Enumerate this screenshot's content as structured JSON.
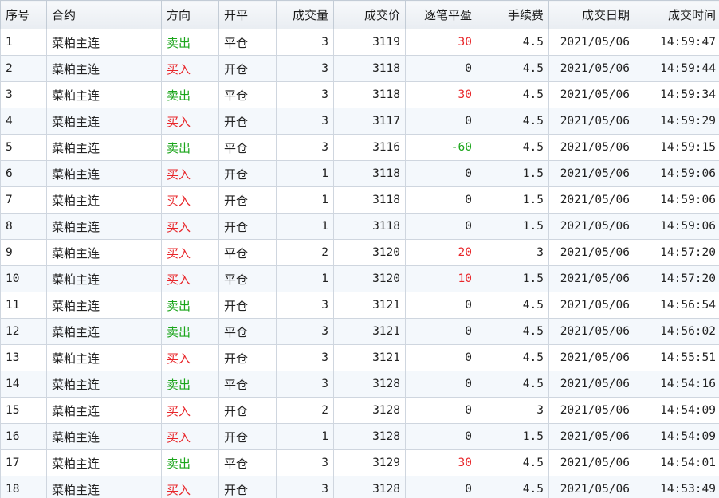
{
  "table": {
    "headers": [
      "序号",
      "合约",
      "方向",
      "开平",
      "成交量",
      "成交价",
      "逐笔平盈",
      "手续费",
      "成交日期",
      "成交时间"
    ],
    "rows": [
      {
        "seq": "1",
        "contract": "菜粕主连",
        "direction": "卖出",
        "dir_type": "sell",
        "offset": "平仓",
        "volume": "3",
        "price": "3119",
        "pnl": "30",
        "pnl_type": "pos",
        "fee": "4.5",
        "date": "2021/05/06",
        "time": "14:59:47"
      },
      {
        "seq": "2",
        "contract": "菜粕主连",
        "direction": "买入",
        "dir_type": "buy",
        "offset": "开仓",
        "volume": "3",
        "price": "3118",
        "pnl": "0",
        "pnl_type": "zero",
        "fee": "4.5",
        "date": "2021/05/06",
        "time": "14:59:44"
      },
      {
        "seq": "3",
        "contract": "菜粕主连",
        "direction": "卖出",
        "dir_type": "sell",
        "offset": "平仓",
        "volume": "3",
        "price": "3118",
        "pnl": "30",
        "pnl_type": "pos",
        "fee": "4.5",
        "date": "2021/05/06",
        "time": "14:59:34"
      },
      {
        "seq": "4",
        "contract": "菜粕主连",
        "direction": "买入",
        "dir_type": "buy",
        "offset": "开仓",
        "volume": "3",
        "price": "3117",
        "pnl": "0",
        "pnl_type": "zero",
        "fee": "4.5",
        "date": "2021/05/06",
        "time": "14:59:29"
      },
      {
        "seq": "5",
        "contract": "菜粕主连",
        "direction": "卖出",
        "dir_type": "sell",
        "offset": "平仓",
        "volume": "3",
        "price": "3116",
        "pnl": "-60",
        "pnl_type": "neg",
        "fee": "4.5",
        "date": "2021/05/06",
        "time": "14:59:15"
      },
      {
        "seq": "6",
        "contract": "菜粕主连",
        "direction": "买入",
        "dir_type": "buy",
        "offset": "开仓",
        "volume": "1",
        "price": "3118",
        "pnl": "0",
        "pnl_type": "zero",
        "fee": "1.5",
        "date": "2021/05/06",
        "time": "14:59:06"
      },
      {
        "seq": "7",
        "contract": "菜粕主连",
        "direction": "买入",
        "dir_type": "buy",
        "offset": "开仓",
        "volume": "1",
        "price": "3118",
        "pnl": "0",
        "pnl_type": "zero",
        "fee": "1.5",
        "date": "2021/05/06",
        "time": "14:59:06"
      },
      {
        "seq": "8",
        "contract": "菜粕主连",
        "direction": "买入",
        "dir_type": "buy",
        "offset": "开仓",
        "volume": "1",
        "price": "3118",
        "pnl": "0",
        "pnl_type": "zero",
        "fee": "1.5",
        "date": "2021/05/06",
        "time": "14:59:06"
      },
      {
        "seq": "9",
        "contract": "菜粕主连",
        "direction": "买入",
        "dir_type": "buy",
        "offset": "平仓",
        "volume": "2",
        "price": "3120",
        "pnl": "20",
        "pnl_type": "pos",
        "fee": "3",
        "date": "2021/05/06",
        "time": "14:57:20"
      },
      {
        "seq": "10",
        "contract": "菜粕主连",
        "direction": "买入",
        "dir_type": "buy",
        "offset": "平仓",
        "volume": "1",
        "price": "3120",
        "pnl": "10",
        "pnl_type": "pos",
        "fee": "1.5",
        "date": "2021/05/06",
        "time": "14:57:20"
      },
      {
        "seq": "11",
        "contract": "菜粕主连",
        "direction": "卖出",
        "dir_type": "sell",
        "offset": "开仓",
        "volume": "3",
        "price": "3121",
        "pnl": "0",
        "pnl_type": "zero",
        "fee": "4.5",
        "date": "2021/05/06",
        "time": "14:56:54"
      },
      {
        "seq": "12",
        "contract": "菜粕主连",
        "direction": "卖出",
        "dir_type": "sell",
        "offset": "平仓",
        "volume": "3",
        "price": "3121",
        "pnl": "0",
        "pnl_type": "zero",
        "fee": "4.5",
        "date": "2021/05/06",
        "time": "14:56:02"
      },
      {
        "seq": "13",
        "contract": "菜粕主连",
        "direction": "买入",
        "dir_type": "buy",
        "offset": "开仓",
        "volume": "3",
        "price": "3121",
        "pnl": "0",
        "pnl_type": "zero",
        "fee": "4.5",
        "date": "2021/05/06",
        "time": "14:55:51"
      },
      {
        "seq": "14",
        "contract": "菜粕主连",
        "direction": "卖出",
        "dir_type": "sell",
        "offset": "平仓",
        "volume": "3",
        "price": "3128",
        "pnl": "0",
        "pnl_type": "zero",
        "fee": "4.5",
        "date": "2021/05/06",
        "time": "14:54:16"
      },
      {
        "seq": "15",
        "contract": "菜粕主连",
        "direction": "买入",
        "dir_type": "buy",
        "offset": "开仓",
        "volume": "2",
        "price": "3128",
        "pnl": "0",
        "pnl_type": "zero",
        "fee": "3",
        "date": "2021/05/06",
        "time": "14:54:09"
      },
      {
        "seq": "16",
        "contract": "菜粕主连",
        "direction": "买入",
        "dir_type": "buy",
        "offset": "开仓",
        "volume": "1",
        "price": "3128",
        "pnl": "0",
        "pnl_type": "zero",
        "fee": "1.5",
        "date": "2021/05/06",
        "time": "14:54:09"
      },
      {
        "seq": "17",
        "contract": "菜粕主连",
        "direction": "卖出",
        "dir_type": "sell",
        "offset": "平仓",
        "volume": "3",
        "price": "3129",
        "pnl": "30",
        "pnl_type": "pos",
        "fee": "4.5",
        "date": "2021/05/06",
        "time": "14:54:01"
      },
      {
        "seq": "18",
        "contract": "菜粕主连",
        "direction": "买入",
        "dir_type": "buy",
        "offset": "开仓",
        "volume": "3",
        "price": "3128",
        "pnl": "0",
        "pnl_type": "zero",
        "fee": "4.5",
        "date": "2021/05/06",
        "time": "14:53:49"
      }
    ]
  },
  "colors": {
    "buy": "#e8262a",
    "sell": "#1aa51a",
    "profit": "#e8262a",
    "loss": "#1aa51a",
    "header_bg": "#eef1f5",
    "alt_row_bg": "#f4f8fc",
    "grid_line": "#cfd6df"
  }
}
